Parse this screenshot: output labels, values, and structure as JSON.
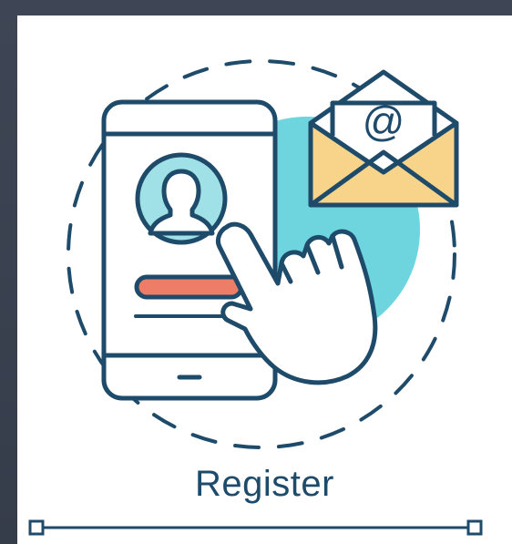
{
  "caption": {
    "text": "Register"
  },
  "icons": {
    "envelope": "at-sign-envelope-icon",
    "profile": "user-avatar-icon",
    "hand": "pointing-hand-icon",
    "device": "tablet-icon"
  },
  "colors": {
    "background": "#3a4150",
    "card": "#ffffff",
    "outline": "#1f4b6b",
    "accent_cyan": "#6ed4de",
    "accent_yellow": "#f8d38a",
    "accent_red": "#ee7d68"
  }
}
